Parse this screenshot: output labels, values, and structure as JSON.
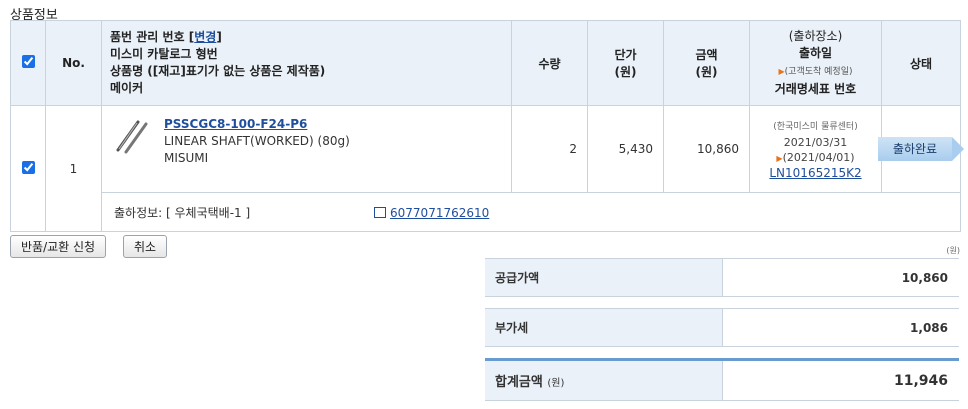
{
  "section_title": "상품정보",
  "header": {
    "no": "No.",
    "product_line1_prefix": "품번 관리 번호 [",
    "product_change_link": "변경",
    "product_line1_suffix": "]",
    "product_line2": "미스미 카탈로그 형번",
    "product_line3": "상품명 ([재고]표기가 없는 상품은 제작품)",
    "product_line4": "메이커",
    "qty": "수량",
    "unit_price": "단가",
    "unit_price_unit": "(원)",
    "amount": "금액",
    "amount_unit": "(원)",
    "ship_place": "(출하장소)",
    "ship_date": "출하일",
    "ship_expected": "(고객도착 예정일)",
    "invoice_no": "거래명세표 번호",
    "status": "상태"
  },
  "item": {
    "no": "1",
    "part_number": "PSSCGC8-100-F24-P6",
    "name": "LINEAR SHAFT(WORKED)  (80g)",
    "maker": "MISUMI",
    "qty": "2",
    "unit_price": "5,430",
    "amount": "10,860",
    "ship_place": "(한국미스미 물류센터)",
    "ship_date": "2021/03/31",
    "arrival_date": "(2021/04/01)",
    "invoice_no": "LN10165215K2",
    "status": "출하완료"
  },
  "shipping_info": {
    "label": "출하정보: [ 우체국택배-1 ]",
    "tracking_no": "6077071762610"
  },
  "buttons": {
    "return": "반품/교환 신청",
    "cancel": "취소"
  },
  "summary": {
    "unit_note": "(원)",
    "supply_label": "공급가액",
    "supply_value": "10,860",
    "vat_label": "부가세",
    "vat_value": "1,086",
    "total_label": "합계금액",
    "total_unit": "(원)",
    "total_value": "11,946"
  },
  "colors": {
    "header_bg": "#eaf1f8",
    "link": "#1f4f9c",
    "status_badge": "#a9cdee"
  }
}
